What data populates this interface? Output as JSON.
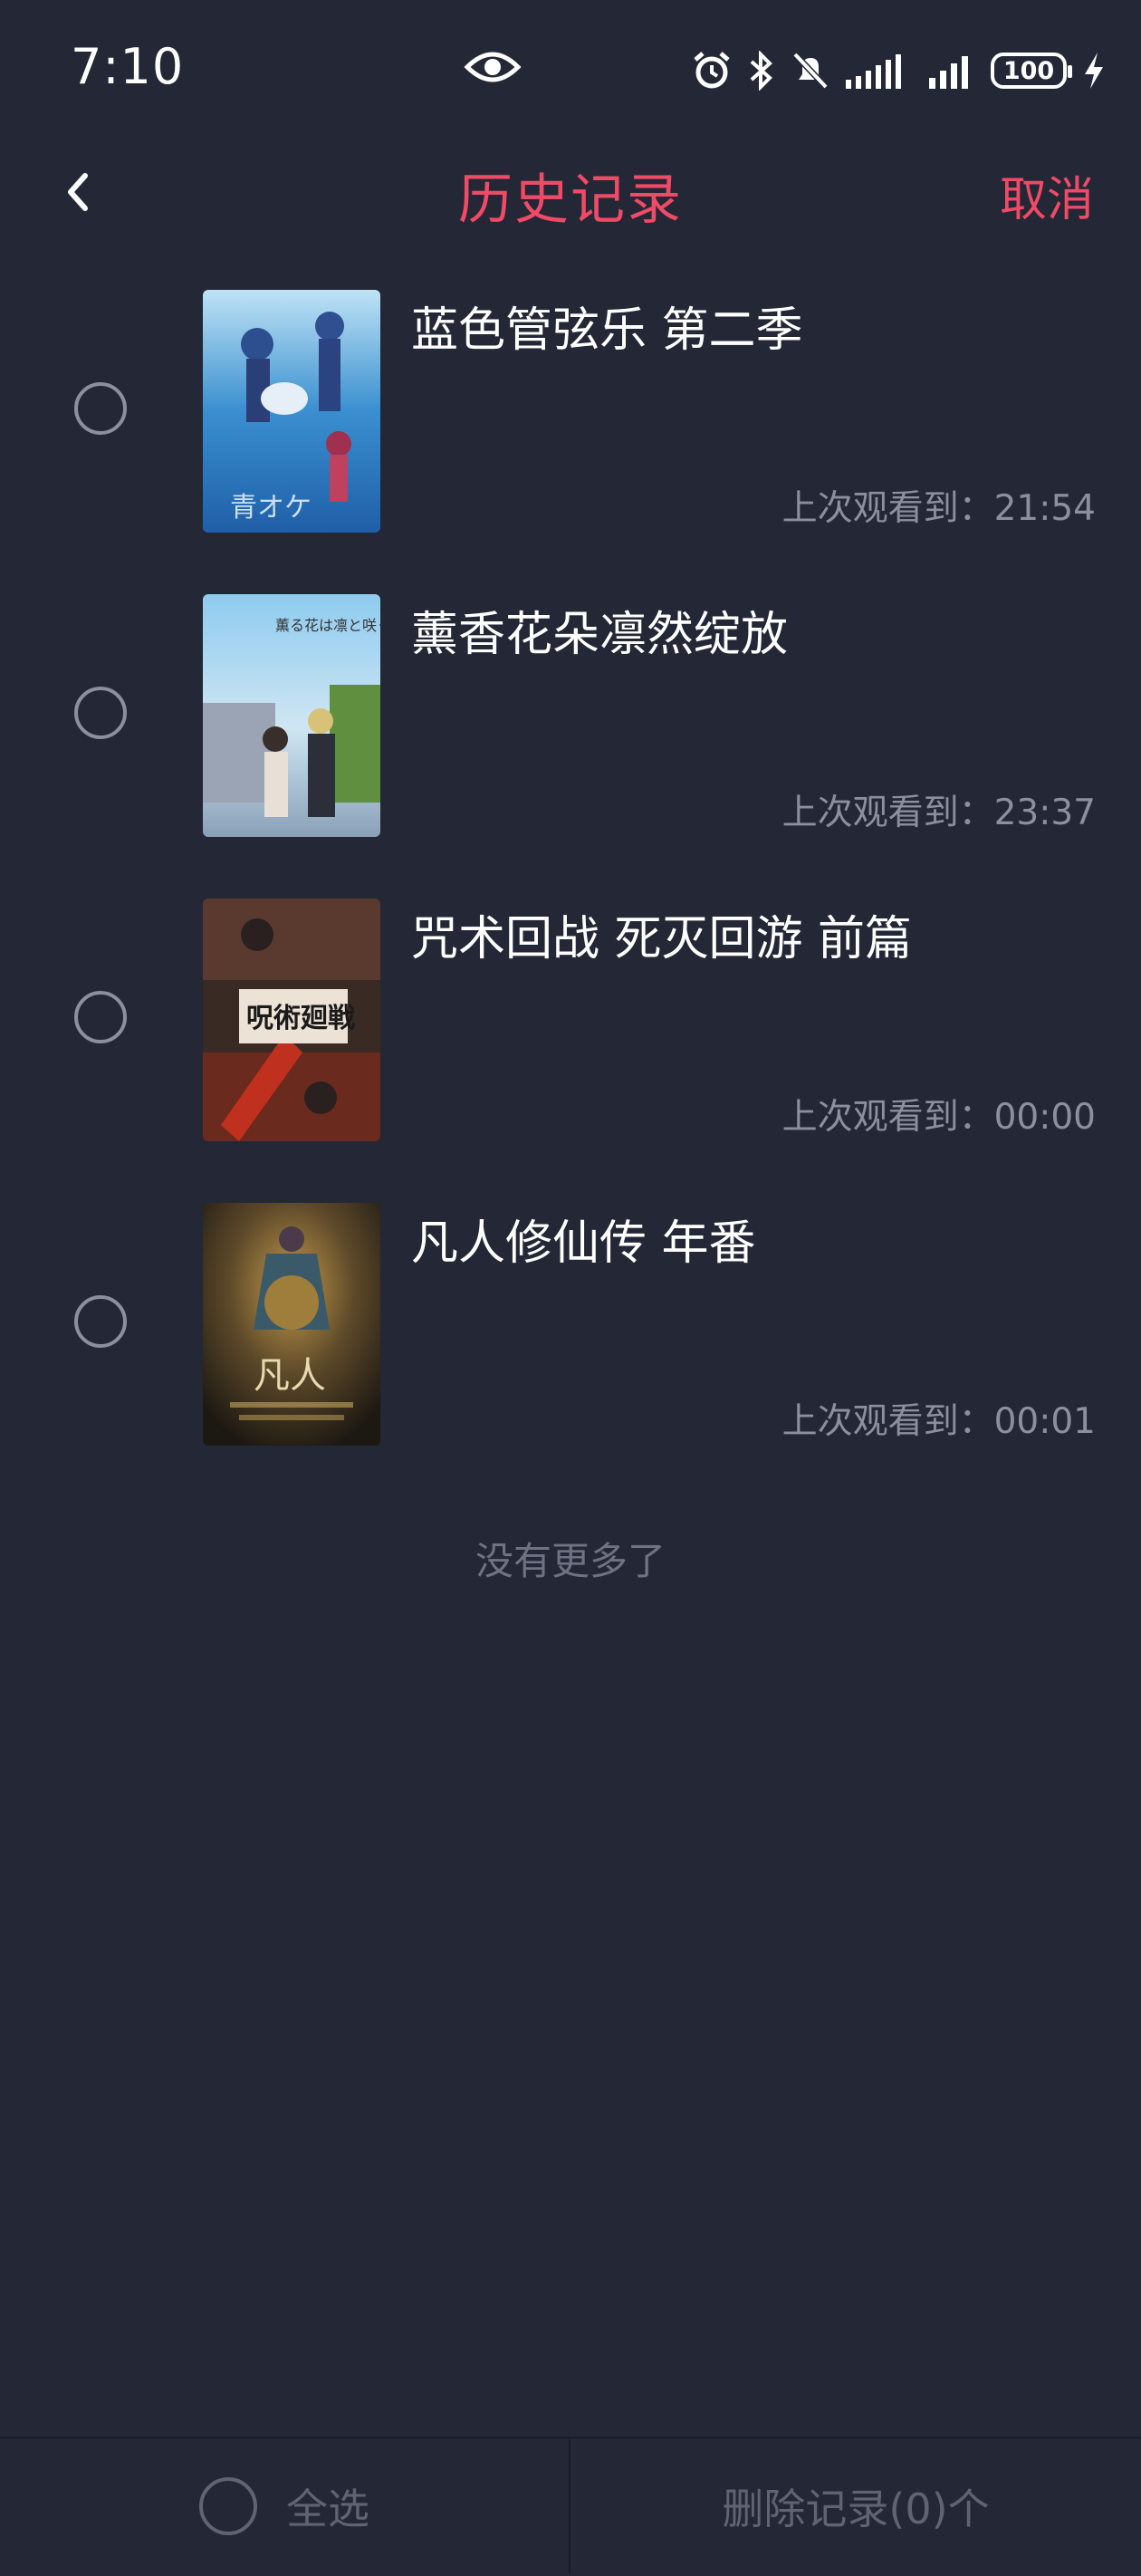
{
  "status_bar": {
    "time": "7:10",
    "battery": "100",
    "icons": [
      "eye-icon",
      "alarm-icon",
      "bluetooth-icon",
      "mute-icon",
      "signal-icon",
      "signal-icon",
      "battery-icon",
      "charging-icon"
    ]
  },
  "header": {
    "title": "历史记录",
    "cancel_label": "取消",
    "back_icon": "chevron-left-icon",
    "accent_color": "#ef4a66"
  },
  "history": {
    "items": [
      {
        "title": "蓝色管弦乐 第二季",
        "progress": "上次观看到：21:54"
      },
      {
        "title": "薰香花朵凛然绽放",
        "progress": "上次观看到：23:37"
      },
      {
        "title": "咒术回战 死灭回游 前篇",
        "progress": "上次观看到：00:00"
      },
      {
        "title": "凡人修仙传 年番",
        "progress": "上次观看到：00:01"
      }
    ],
    "end_text": "没有更多了"
  },
  "footer": {
    "select_all_label": "全选",
    "delete_label": "删除记录(0)个"
  },
  "colors": {
    "background": "#232736",
    "accent": "#ef4a66",
    "muted_text": "#8d909c"
  }
}
